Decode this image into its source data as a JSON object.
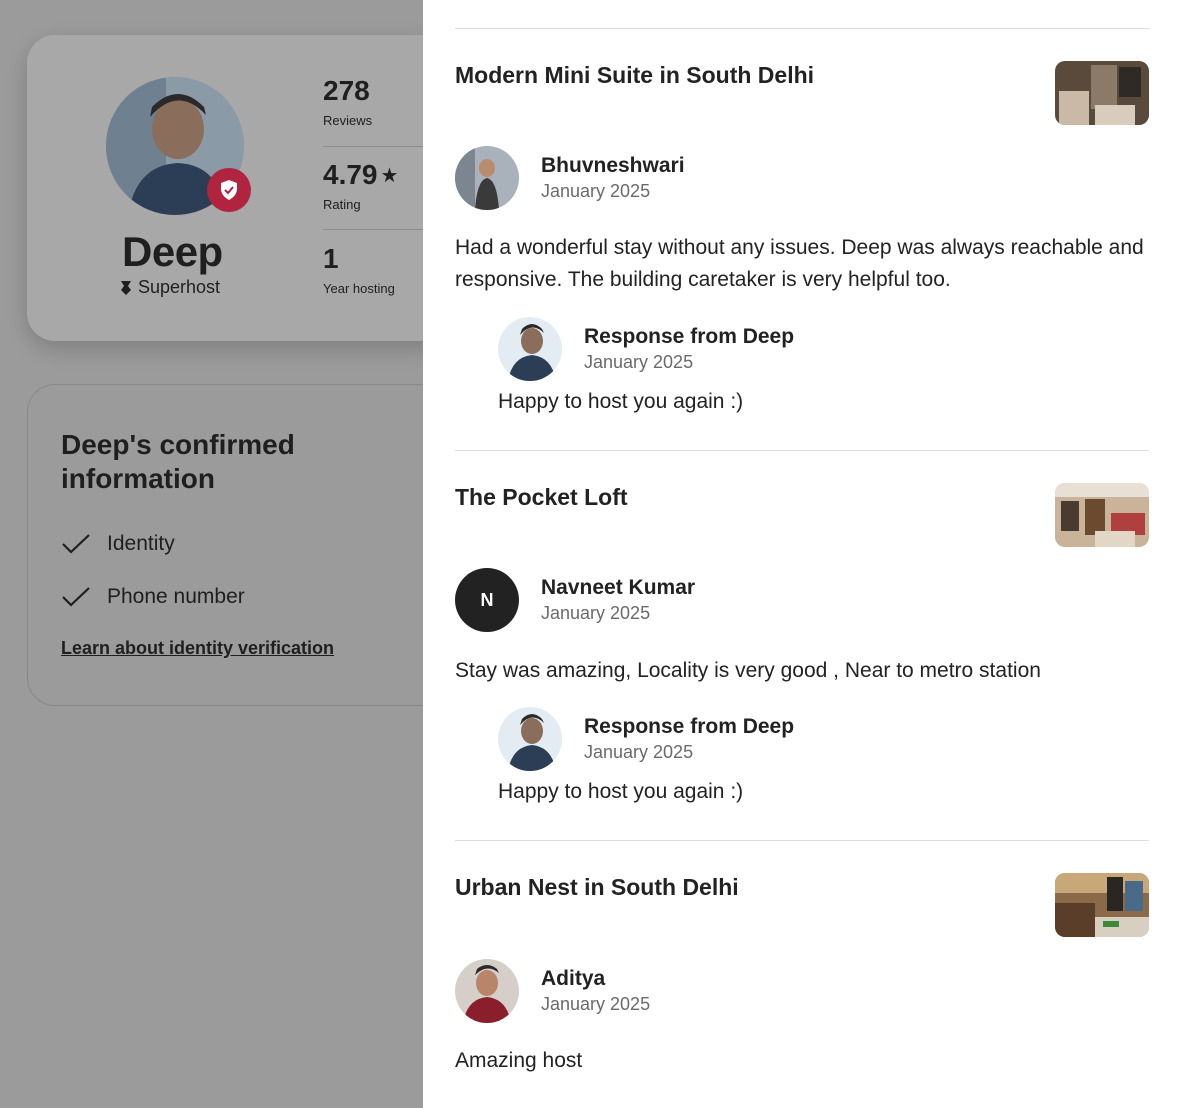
{
  "host": {
    "name": "Deep",
    "badge": "Superhost",
    "stats": [
      {
        "value": "278",
        "label": "Reviews"
      },
      {
        "value": "4.79",
        "label": "Rating"
      },
      {
        "value": "1",
        "label": "Year hosting"
      }
    ]
  },
  "confirmed": {
    "title": "Deep's confirmed information",
    "items": [
      "Identity",
      "Phone number"
    ],
    "link": "Learn about identity verification"
  },
  "reviews": [
    {
      "listing": "Modern Mini Suite in South Delhi",
      "reviewer": "Bhuvneshwari",
      "date": "January 2025",
      "text": "Had a wonderful stay without any issues. Deep was always reachable and responsive. The building caretaker is very helpful too.",
      "response_title": "Response from Deep",
      "response_date": "January 2025",
      "response_text": "Happy to host you again :)"
    },
    {
      "listing": "The Pocket Loft",
      "reviewer": "Navneet Kumar",
      "reviewer_initial": "N",
      "date": "January 2025",
      "text": "Stay was amazing, Locality is very good , Near to metro station",
      "response_title": "Response from Deep",
      "response_date": "January 2025",
      "response_text": "Happy to host you again :)"
    },
    {
      "listing": "Urban Nest in South Delhi",
      "reviewer": "Aditya",
      "date": "January 2025",
      "text": "Amazing host"
    }
  ],
  "colors": {
    "brand": "#b0243f",
    "overlay": "#9b9b9b",
    "text": "#222222",
    "muted": "#6a6a6a"
  }
}
